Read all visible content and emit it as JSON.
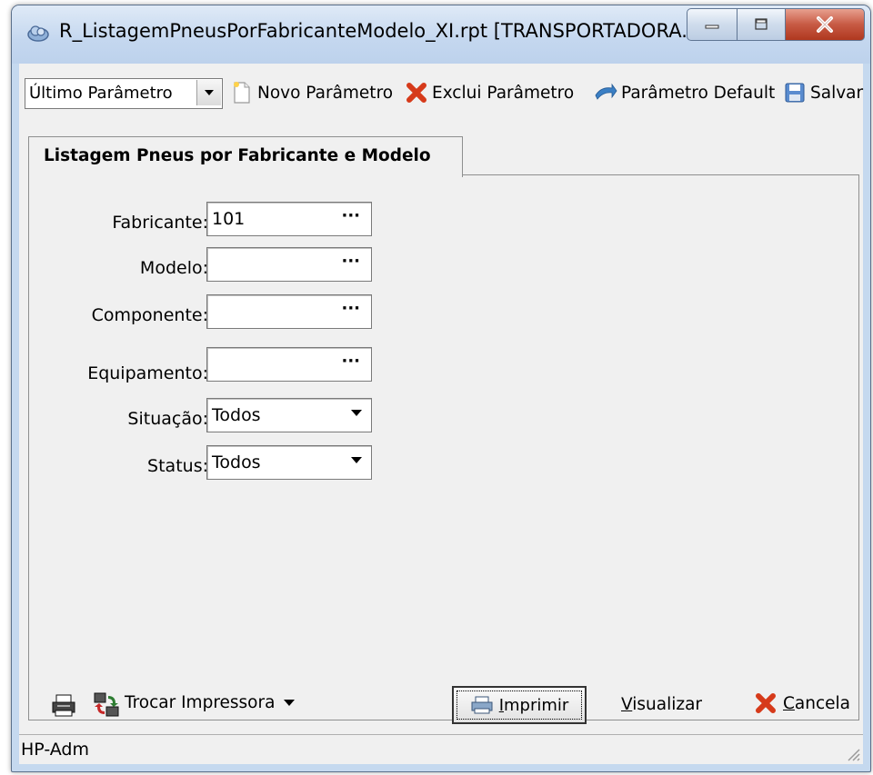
{
  "window": {
    "title": "R_ListagemPneusPorFabricanteModelo_XI.rpt [TRANSPORTADORA...",
    "app_icon": "cloud-icon"
  },
  "toolbar": {
    "param_combo_value": "Último Parâmetro",
    "novo": "Novo Parâmetro",
    "exclui": "Exclui Parâmetro",
    "default": "Parâmetro Default",
    "salvar": "Salvar"
  },
  "tab": {
    "label": "Listagem Pneus por Fabricante e Modelo"
  },
  "form": {
    "fabricante_label": "Fabricante:",
    "fabricante_value": "101",
    "modelo_label": "Modelo:",
    "modelo_value": "",
    "componente_label": "Componente:",
    "componente_value": "",
    "equipamento_label": "Equipamento:",
    "equipamento_value": "",
    "situacao_label": "Situação:",
    "situacao_value": "Todos",
    "status_label": "Status:",
    "status_value": "Todos",
    "lookup_glyph": "···"
  },
  "bottom": {
    "trocar": "Trocar Impressora",
    "imprimir_u": "I",
    "imprimir_rest": "mprimir",
    "visualizar_u": "V",
    "visualizar_rest": "isualizar",
    "cancela_u": "C",
    "cancela_rest": "ancela"
  },
  "status": {
    "text": "HP-Adm"
  },
  "colors": {
    "close_red": "#c75a44",
    "title_bg": "#c4d7ef",
    "client_bg": "#f0f0f0"
  }
}
